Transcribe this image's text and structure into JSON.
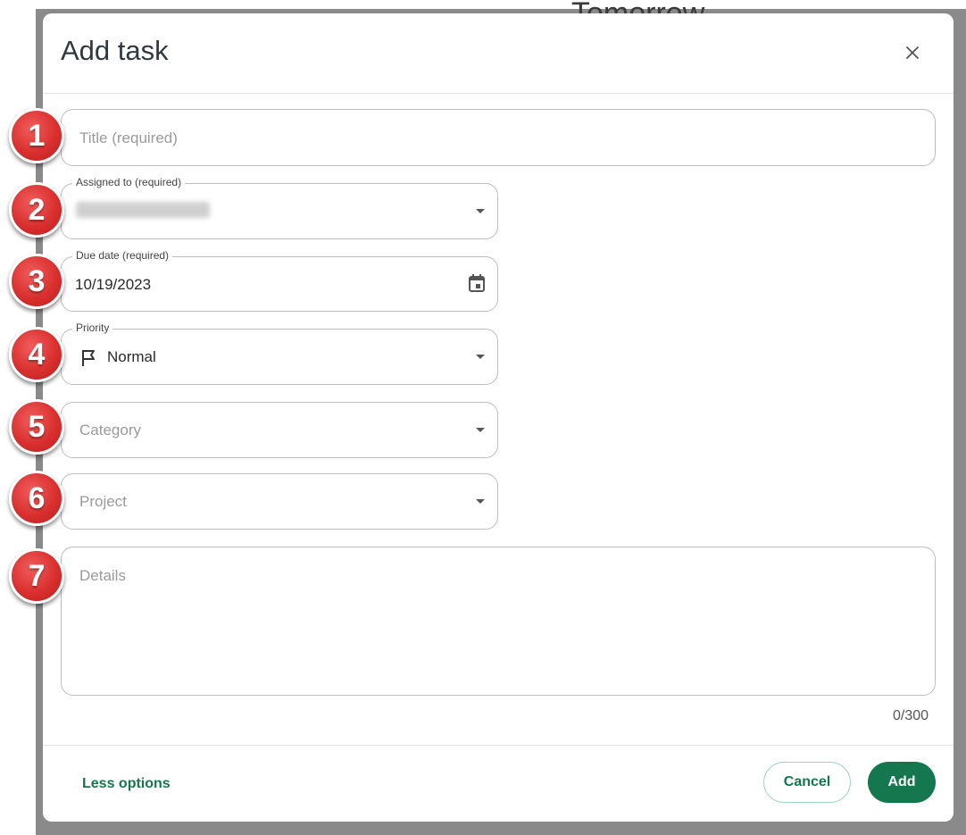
{
  "background": {
    "heading_fragment": "Tomorrow",
    "edge_digit": "1"
  },
  "dialog": {
    "title": "Add task",
    "close_icon": "close-icon"
  },
  "fields": {
    "title": {
      "placeholder": "Title (required)"
    },
    "assigned_to": {
      "label": "Assigned to (required)",
      "value": "Catherine Holliday"
    },
    "due_date": {
      "label": "Due date (required)",
      "value": "10/19/2023",
      "icon": "calendar-icon"
    },
    "priority": {
      "label": "Priority",
      "value": "Normal",
      "icon": "flag-icon"
    },
    "category": {
      "placeholder": "Category"
    },
    "project": {
      "placeholder": "Project"
    },
    "details": {
      "placeholder": "Details",
      "counter": "0/300"
    }
  },
  "footer": {
    "less_options": "Less options",
    "cancel": "Cancel",
    "add": "Add"
  },
  "badges": [
    "1",
    "2",
    "3",
    "4",
    "5",
    "6",
    "7"
  ],
  "colors": {
    "accent": "#14774e",
    "badge": "#d9302f"
  }
}
